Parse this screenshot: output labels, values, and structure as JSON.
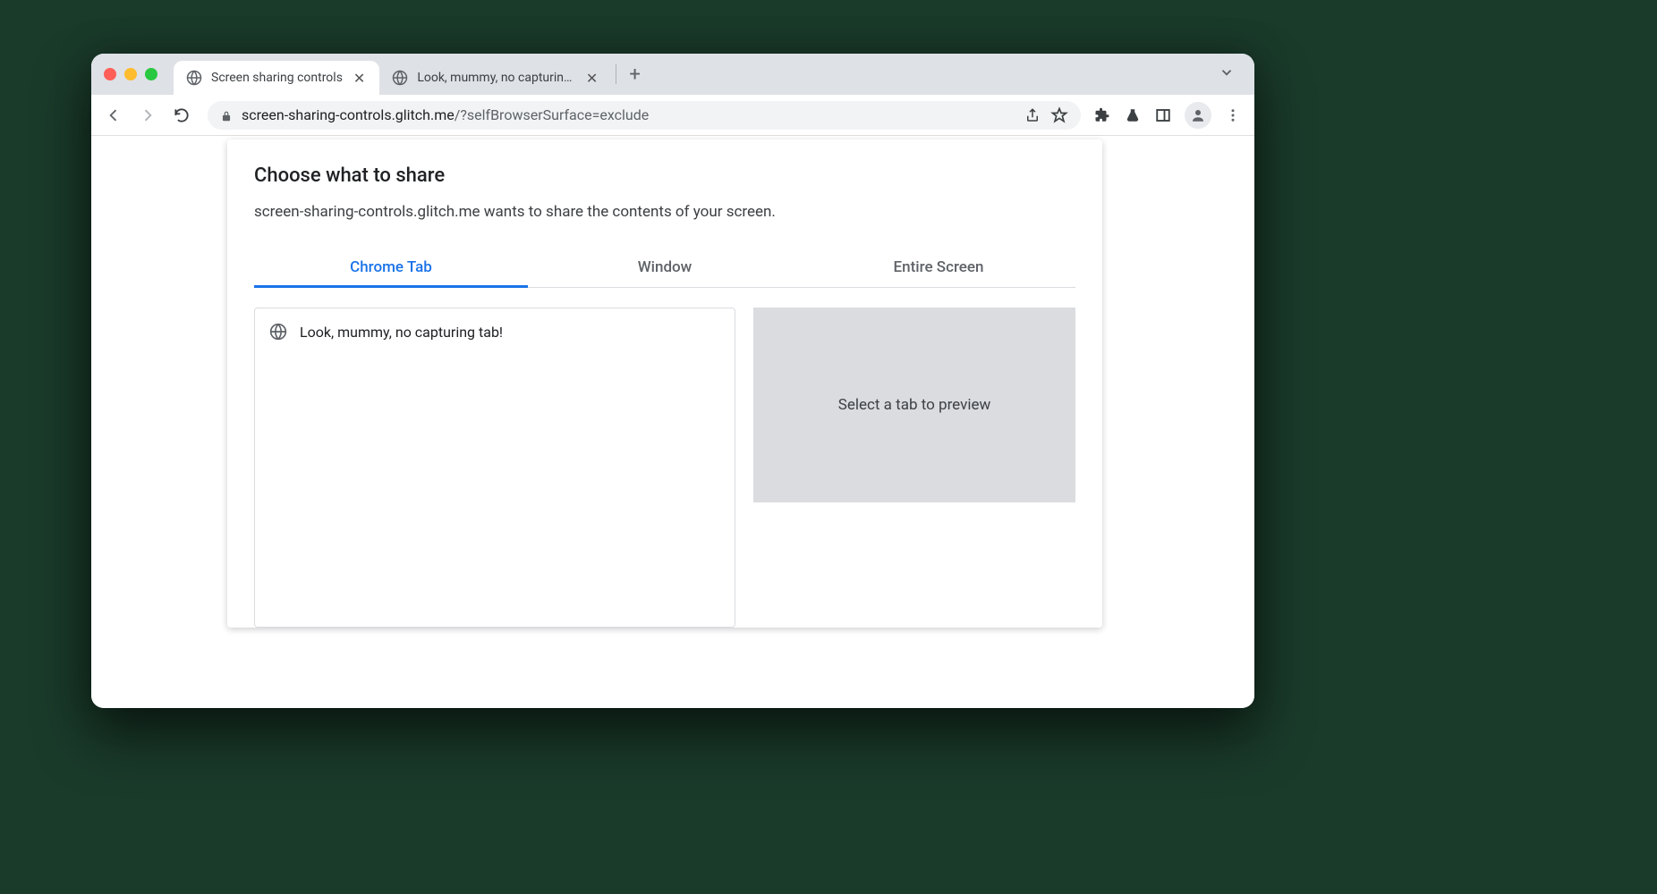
{
  "browser": {
    "tabs": [
      {
        "title": "Screen sharing controls",
        "active": true
      },
      {
        "title": "Look, mummy, no capturing tab",
        "active": false
      }
    ],
    "url_host": "screen-sharing-controls.glitch.me",
    "url_path": "/?selfBrowserSurface=exclude"
  },
  "dialog": {
    "title": "Choose what to share",
    "subtitle": "screen-sharing-controls.glitch.me wants to share the contents of your screen.",
    "tabs": {
      "chrome_tab": "Chrome Tab",
      "window": "Window",
      "entire_screen": "Entire Screen"
    },
    "tab_list": [
      "Look, mummy, no capturing tab!"
    ],
    "preview_placeholder": "Select a tab to preview"
  }
}
